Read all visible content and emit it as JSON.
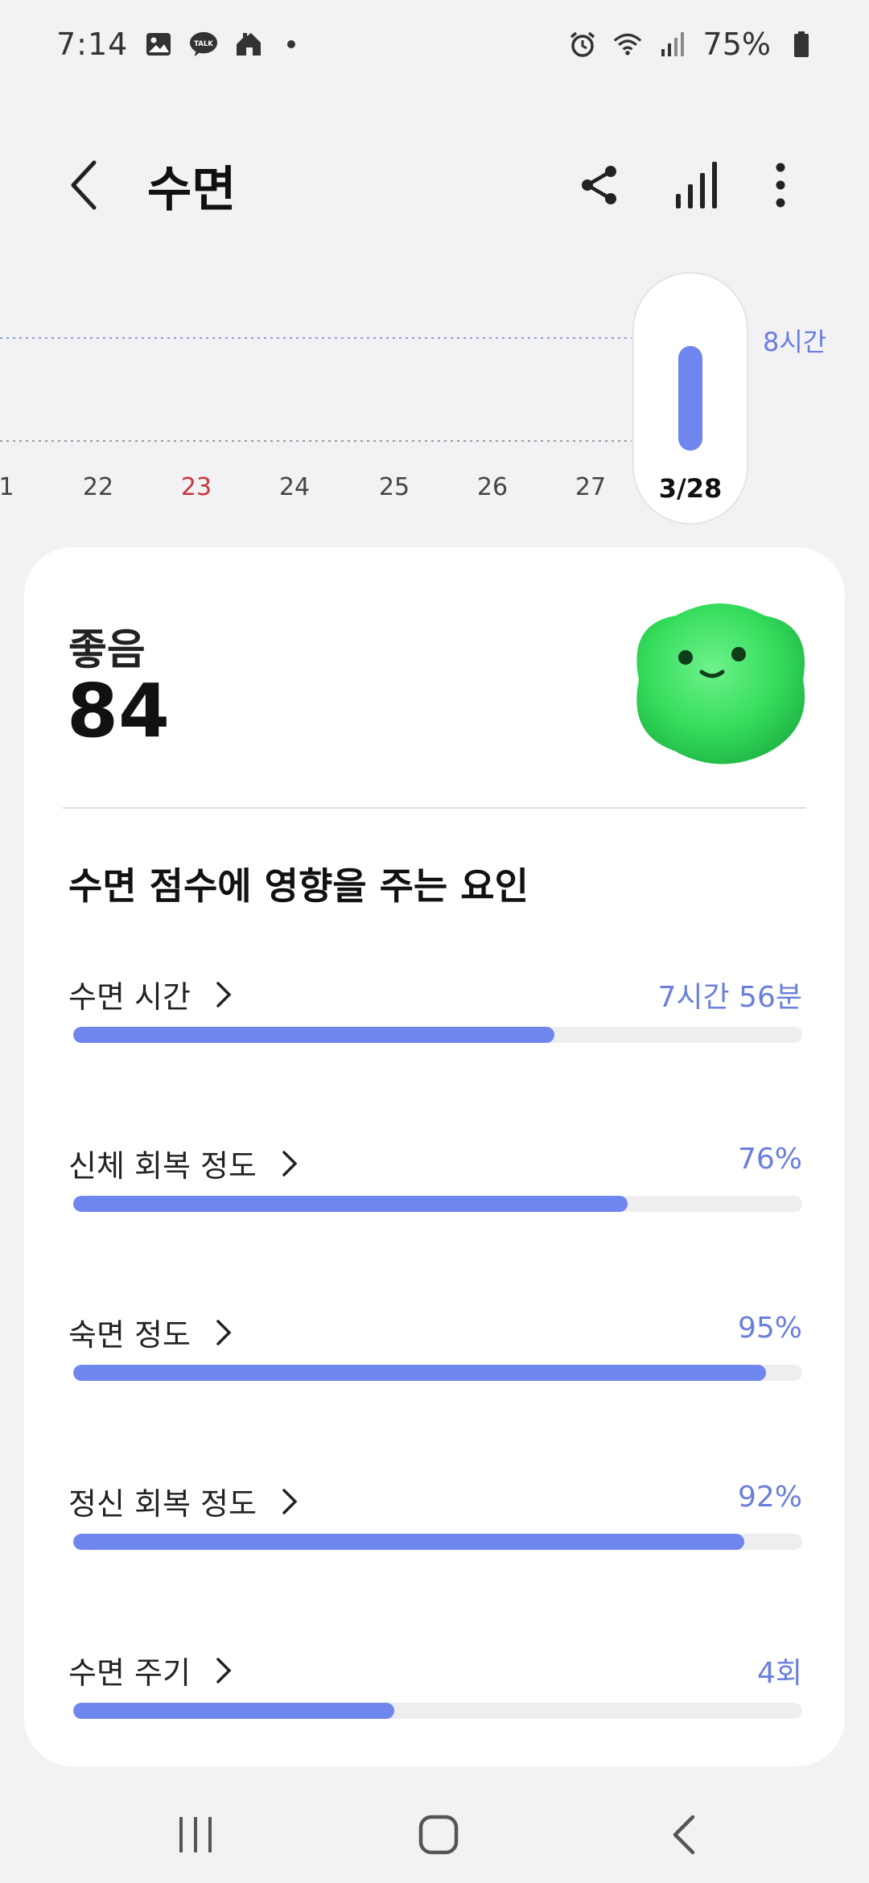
{
  "status_bar": {
    "time": "7:14",
    "battery": "75%",
    "icons": [
      "gallery-icon",
      "kakaotalk-icon",
      "home-app-icon",
      "alarm-icon",
      "wifi-icon",
      "signal-icon",
      "battery-icon"
    ]
  },
  "app_bar": {
    "title": "수면",
    "back_icon": "chevron-left-icon",
    "actions": [
      "share-icon",
      "bar-chart-icon",
      "more-vert-icon"
    ]
  },
  "day_chart": {
    "days": [
      "1",
      "22",
      "23",
      "24",
      "25",
      "26",
      "27",
      "3/28"
    ],
    "sunday_day": "23",
    "selected_day": "3/28",
    "reference_label": "8시간",
    "selected_sleep_fraction_of_8h": 0.99,
    "accent_color": "#6f86ee"
  },
  "summary": {
    "label": "좋음",
    "score": "84",
    "mascot_icon": "green-fluffy-mascot-icon"
  },
  "factors_section": {
    "title": "수면 점수에 영향을 주는 요인",
    "items": [
      {
        "label": "수면 시간",
        "value": "7시간 56분",
        "fill_fraction": 0.66
      },
      {
        "label": "신체 회복 정도",
        "value": "76%",
        "fill_fraction": 0.76
      },
      {
        "label": "숙면 정도",
        "value": "95%",
        "fill_fraction": 0.95
      },
      {
        "label": "정신 회복 정도",
        "value": "92%",
        "fill_fraction": 0.92
      },
      {
        "label": "수면 주기",
        "value": "4회",
        "fill_fraction": 0.44
      }
    ]
  },
  "nav_bar": {
    "icons": [
      "recents-icon",
      "home-icon",
      "back-icon"
    ]
  }
}
